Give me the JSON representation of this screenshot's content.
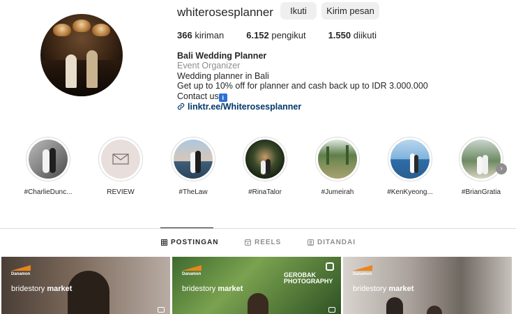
{
  "profile": {
    "username": "whiterosesplanner",
    "follow_label": "Ikuti",
    "message_label": "Kirim pesan",
    "stats": {
      "posts": "366",
      "posts_label": "kiriman",
      "followers": "6.152",
      "followers_label": "pengikut",
      "following": "1.550",
      "following_label": "diikuti"
    },
    "bio": {
      "name": "Bali Wedding Planner",
      "category": "Event Organizer",
      "line1": "Wedding planner in Bali",
      "line2": "Get up to 10% off for planner and cash back up to IDR 3.000.000",
      "line3": "Contact us",
      "info_badge": "i",
      "link": "linktr.ee/Whiterosesplanner"
    }
  },
  "highlights": [
    {
      "label": "#CharlieDunc...",
      "icon": "bw-couple-photo"
    },
    {
      "label": "REVIEW",
      "icon": "envelope-icon"
    },
    {
      "label": "#TheLaw",
      "icon": "sunset-couple-photo"
    },
    {
      "label": "#RinaTalor",
      "icon": "forest-arch-photo"
    },
    {
      "label": "#Jumeirah",
      "icon": "garden-photo"
    },
    {
      "label": "#KenKyeong...",
      "icon": "sea-couple-photo"
    },
    {
      "label": "#BrianGratia",
      "icon": "trees-couple-photo"
    }
  ],
  "tabs": [
    {
      "label": "POSTINGAN",
      "active": true,
      "icon": "grid-icon"
    },
    {
      "label": "REELS",
      "active": false,
      "icon": "reels-icon"
    },
    {
      "label": "DITANDAI",
      "active": false,
      "icon": "tagged-icon"
    }
  ],
  "posts": [
    {
      "brand_small": "Danamon",
      "brand_text_light": "bridestory",
      "brand_text_bold": "market"
    },
    {
      "brand_small": "Danamon",
      "brand_text_light": "bridestory",
      "brand_text_bold": "market",
      "watermark_line1": "GEROBAK",
      "watermark_line2": "PHOTOGRAPHY"
    },
    {
      "brand_small": "Danamon",
      "brand_text_light": "bridestory",
      "brand_text_bold": "market"
    }
  ],
  "colors": {
    "text": "#262626",
    "muted": "#8e8e8e",
    "link": "#00376b",
    "button_bg": "#efefef",
    "border": "#dbdbdb",
    "brand_orange": "#e9851a"
  }
}
